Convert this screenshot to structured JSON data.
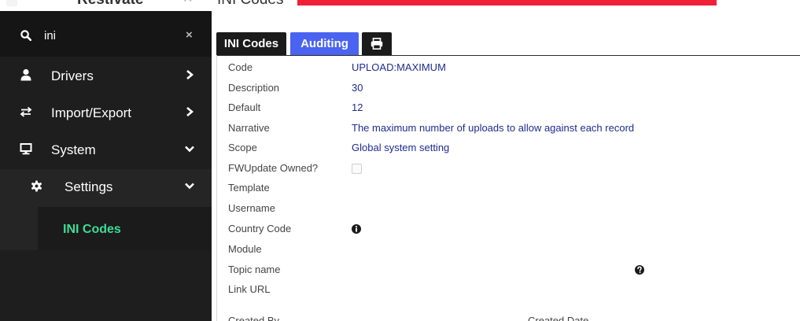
{
  "header": {
    "brand": "Restivate",
    "page_title": "INI Codes",
    "brand_color": "#e8344a",
    "redaction_color": "#f0203a"
  },
  "sidebar": {
    "search_value": "ini",
    "search_icon": "search-icon",
    "clear_symbol": "×",
    "items": [
      {
        "label": "Drivers",
        "icon": "user-icon",
        "chevron": "chevron-right-icon"
      },
      {
        "label": "Import/Export",
        "icon": "exchange-icon",
        "chevron": "chevron-right-icon"
      },
      {
        "label": "System",
        "icon": "desktop-icon",
        "chevron": "chevron-down-icon"
      }
    ],
    "submenu": {
      "label": "Settings",
      "icon": "gear-icon",
      "chevron": "chevron-down-icon",
      "active_item": "INI Codes",
      "active_color": "#3ddc97"
    }
  },
  "tabs": [
    {
      "label": "INI Codes",
      "active": false
    },
    {
      "label": "Auditing",
      "active": true
    },
    {
      "label": "",
      "icon": "print-icon"
    }
  ],
  "fields": [
    {
      "label": "Code",
      "value": "UPLOAD:MAXIMUM"
    },
    {
      "label": "Description",
      "value": "30"
    },
    {
      "label": "Default",
      "value": "12"
    },
    {
      "label": "Narrative",
      "value": "The maximum number of uploads to allow against each record"
    },
    {
      "label": "Scope",
      "value": "Global system setting"
    },
    {
      "label": "FWUpdate Owned?",
      "value": "",
      "checked": false
    },
    {
      "label": "Template",
      "value": ""
    },
    {
      "label": "Username",
      "value": ""
    },
    {
      "label": "Country Code",
      "value": "",
      "icon": "info-icon"
    },
    {
      "label": "Module",
      "value": ""
    },
    {
      "label": "Topic name",
      "value": "",
      "icon": "help-icon"
    },
    {
      "label": "Link URL",
      "value": ""
    }
  ],
  "footer_labels": {
    "created_by": "Created By",
    "created_date": "Created Date"
  },
  "colors": {
    "sidebar_bg": "#1e1e1e",
    "active_tab": "#4a63f0",
    "value_text": "#1f2b8f"
  }
}
